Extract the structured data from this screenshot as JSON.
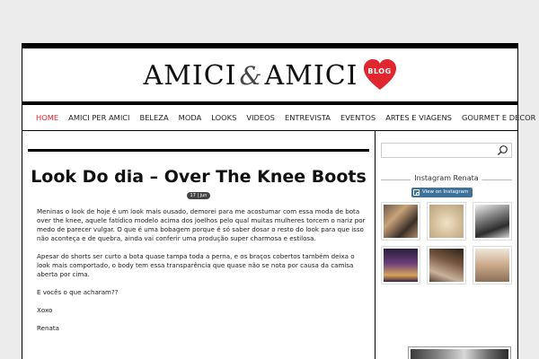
{
  "brand": {
    "word1": "AMICI",
    "amp": "&",
    "word2": "AMICI",
    "badge": "BLOG",
    "accent": "#e0262e"
  },
  "nav": [
    {
      "label": "HOME",
      "active": true
    },
    {
      "label": "AMICI PER AMICI"
    },
    {
      "label": "BELEZA"
    },
    {
      "label": "MODA"
    },
    {
      "label": "LOOKS"
    },
    {
      "label": "VIDEOS"
    },
    {
      "label": "ENTREVISTA"
    },
    {
      "label": "EVENTOS"
    },
    {
      "label": "ARTES E VIAGENS"
    },
    {
      "label": "GOURMET E DECOR"
    }
  ],
  "post": {
    "title": "Look Do dia – Over The Knee Boots",
    "date": "17 | jun",
    "paragraphs": [
      "Meninas o look de hoje é um look mais ousado, demorei para me acostumar com essa moda de bota over the knee, aquele fatídico modelo acima dos joelhos pelo qual muitas mulheres torcem o nariz por medo de parecer vulgar. O que é uma bobagem porque é só saber dosar o resto do look para que isso não aconteça e de quebra, ainda vai conferir uma produção super charmosa e estilosa.",
      "Apesar do shorts ser curto a bota quase tampa toda a perna, e os braços cobertos também deixa o look mais comportado, o body tem essa transparência que quase não se nota por causa da camisa aberta por cima.",
      "E vocês o que acharam??",
      "Xoxo",
      "Renata"
    ]
  },
  "sidebar": {
    "search_placeholder": "",
    "instagram_heading": "Instagram Renata",
    "instagram_button": "View on Instagram",
    "search_icon": "search-icon",
    "instagram_icon": "instagram-icon"
  }
}
